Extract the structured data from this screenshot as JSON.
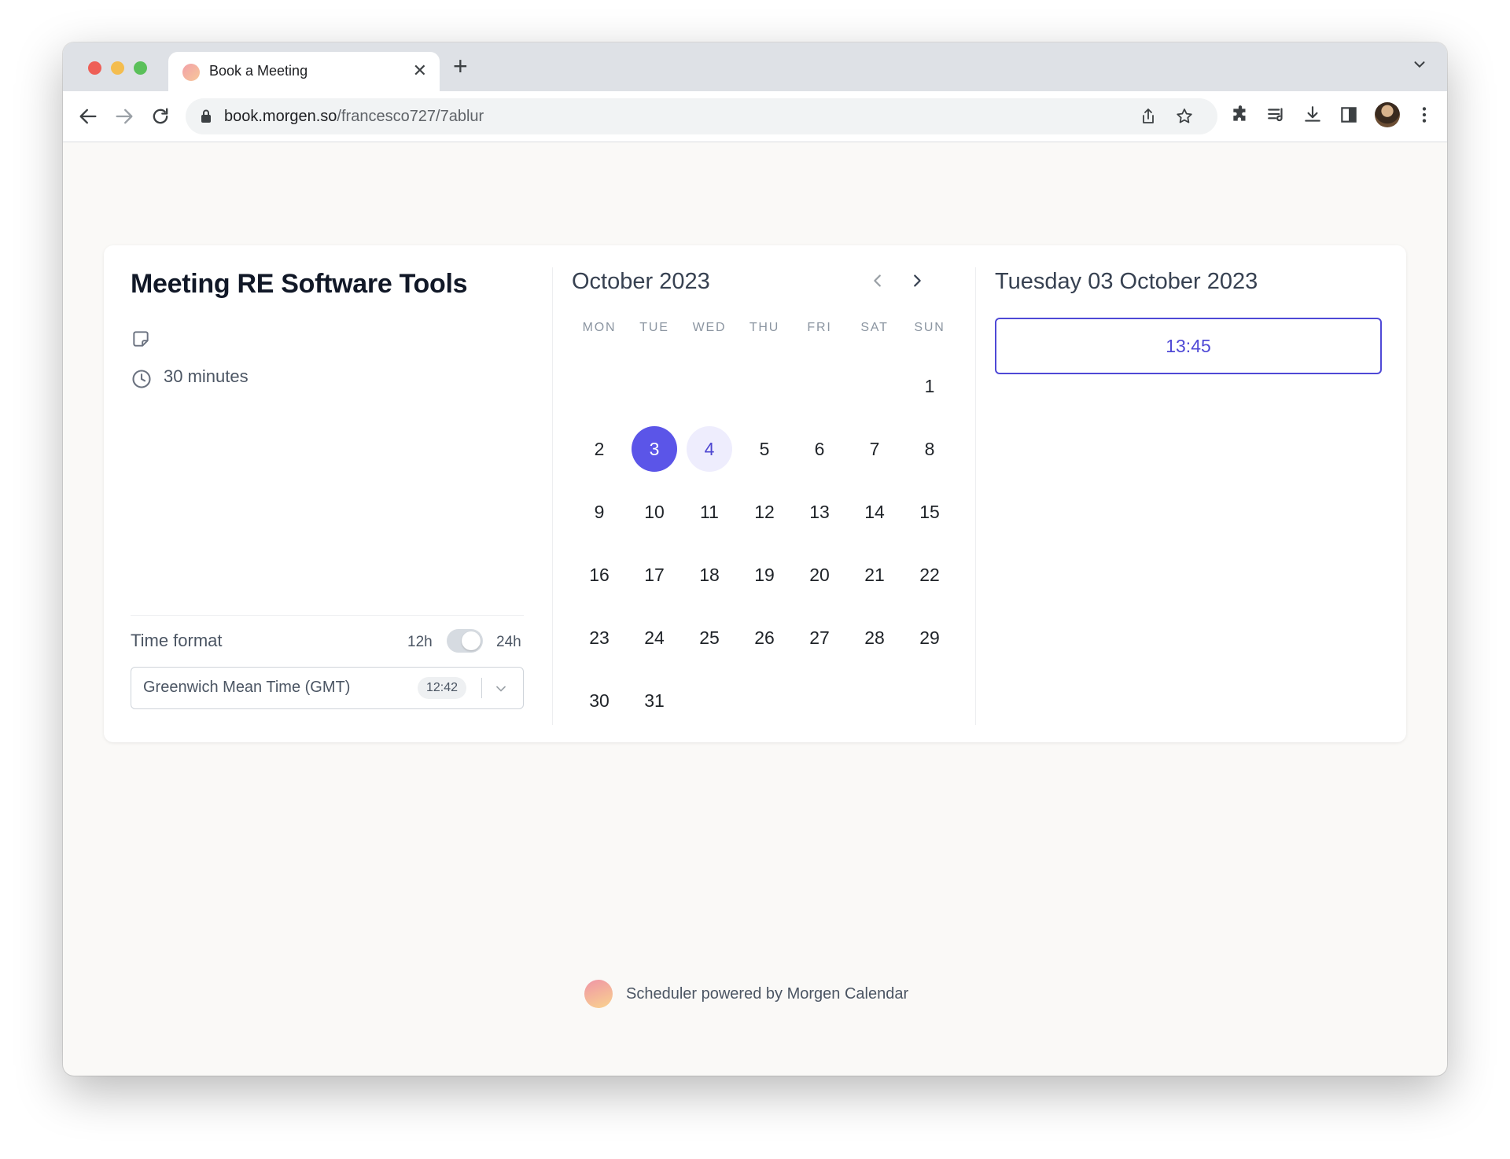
{
  "browser": {
    "tab_title": "Book a Meeting",
    "tab_close": "✕",
    "new_tab": "+",
    "url_host": "book.morgen.so",
    "url_path": "/francesco727/7ablur"
  },
  "meeting": {
    "title": "Meeting RE Software Tools",
    "duration": "30 minutes"
  },
  "time_format": {
    "label": "Time format",
    "option_12h": "12h",
    "option_24h": "24h",
    "selected": "24h"
  },
  "timezone": {
    "name": "Greenwich Mean Time (GMT)",
    "current_time": "12:42"
  },
  "calendar": {
    "month_label": "October 2023",
    "weekdays": [
      "MON",
      "TUE",
      "WED",
      "THU",
      "FRI",
      "SAT",
      "SUN"
    ],
    "first_weekday_index": 6,
    "days_in_month": 31,
    "selected_day": 3,
    "available_days": [
      4
    ]
  },
  "slots": {
    "date_label": "Tuesday 03 October 2023",
    "times": [
      "13:45"
    ]
  },
  "footer": {
    "text": "Scheduler powered by Morgen Calendar"
  },
  "colors": {
    "accent": "#5b55e8",
    "accent_light": "#eeedfd",
    "page_bg": "#faf9f7"
  }
}
